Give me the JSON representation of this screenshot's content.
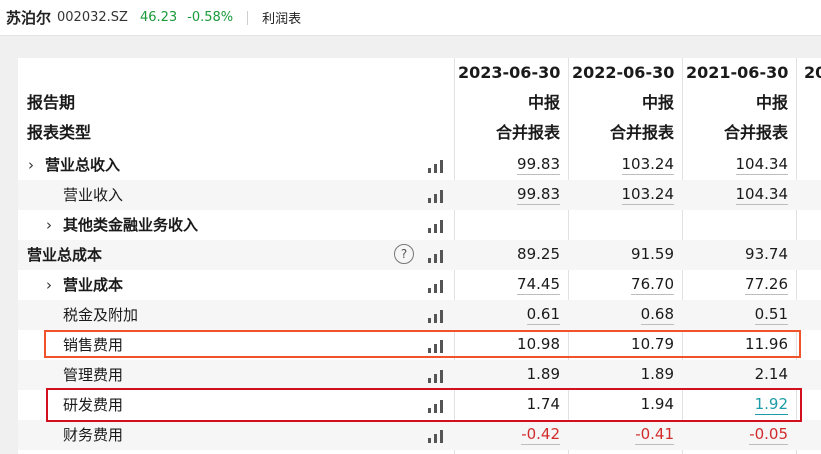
{
  "stock": {
    "name": "苏泊尔",
    "code": "002032.SZ",
    "price": "46.23",
    "change": "-0.58%",
    "tab": "利润表"
  },
  "header": {
    "period_label": "报告期",
    "type_label": "报表类型",
    "columns": [
      {
        "date": "2023-06-30",
        "period": "中报",
        "type": "合并报表"
      },
      {
        "date": "2022-06-30",
        "period": "中报",
        "type": "合并报表"
      },
      {
        "date": "2021-06-30",
        "period": "中报",
        "type": "合并报表"
      },
      {
        "date": "20"
      }
    ]
  },
  "rows": [
    {
      "label": "营业总收入",
      "values": [
        "99.83",
        "103.24",
        "104.34"
      ]
    },
    {
      "label": "营业收入",
      "values": [
        "99.83",
        "103.24",
        "104.34"
      ]
    },
    {
      "label": "其他类金融业务收入",
      "values": [
        "",
        "",
        ""
      ]
    },
    {
      "label": "营业总成本",
      "values": [
        "89.25",
        "91.59",
        "93.74"
      ]
    },
    {
      "label": "营业成本",
      "values": [
        "74.45",
        "76.70",
        "77.26"
      ]
    },
    {
      "label": "税金及附加",
      "values": [
        "0.61",
        "0.68",
        "0.51"
      ]
    },
    {
      "label": "销售费用",
      "values": [
        "10.98",
        "10.79",
        "11.96"
      ]
    },
    {
      "label": "管理费用",
      "values": [
        "1.89",
        "1.89",
        "2.14"
      ]
    },
    {
      "label": "研发费用",
      "values": [
        "1.74",
        "1.94",
        "1.92"
      ]
    },
    {
      "label": "财务费用",
      "values": [
        "-0.42",
        "-0.41",
        "-0.05"
      ]
    }
  ],
  "colors": {
    "positive_change": "#1a9a3a",
    "negative_value": "#d12b2b",
    "link_value": "#1d9ba8",
    "highlight_orange": "#f0522a",
    "highlight_red": "#d0101c"
  },
  "icons": {
    "expand": "chevron-right-icon",
    "chart": "bar-chart-icon",
    "help": "question-circle-icon"
  }
}
